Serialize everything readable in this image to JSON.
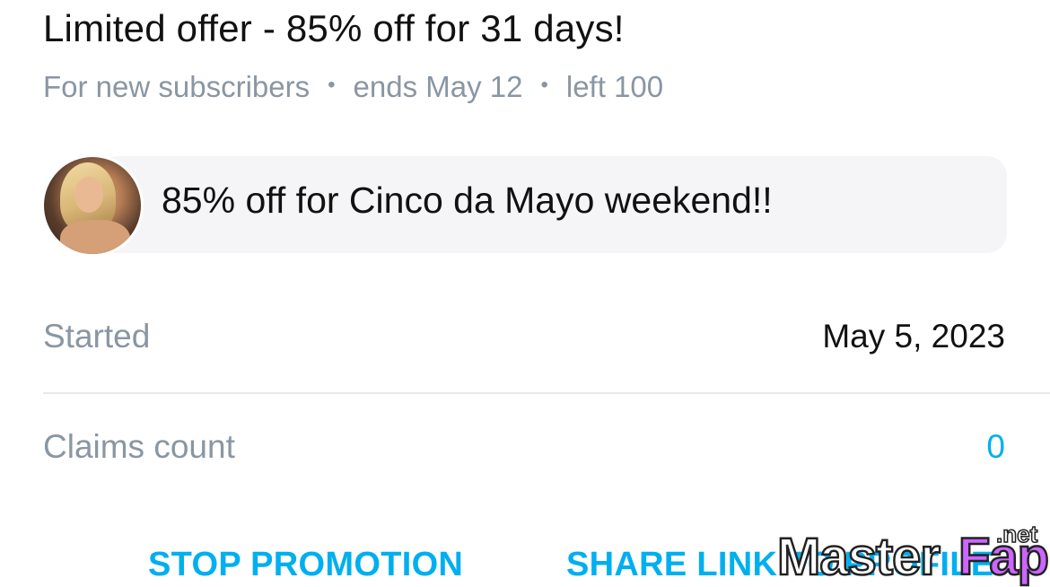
{
  "header": {
    "title": "Limited offer - 85% off for 31 days!",
    "audience": "For new subscribers",
    "ends": "ends May 12",
    "left": "left 100",
    "separator": "•"
  },
  "message": {
    "avatar_icon": "profile-avatar",
    "text": "85% off for Cinco da Mayo weekend!!"
  },
  "details": {
    "started_label": "Started",
    "started_value": "May 5, 2023",
    "claims_label": "Claims count",
    "claims_value": "0"
  },
  "actions": {
    "stop_label": "STOP PROMOTION",
    "share_label": "SHARE LINK TO PROFILE"
  },
  "watermark": {
    "text": "MasterFap",
    "suffix": ".net"
  },
  "colors": {
    "accent": "#00aff0",
    "muted": "#8a96a3",
    "text": "#111111",
    "bubble": "#f5f5f7"
  }
}
